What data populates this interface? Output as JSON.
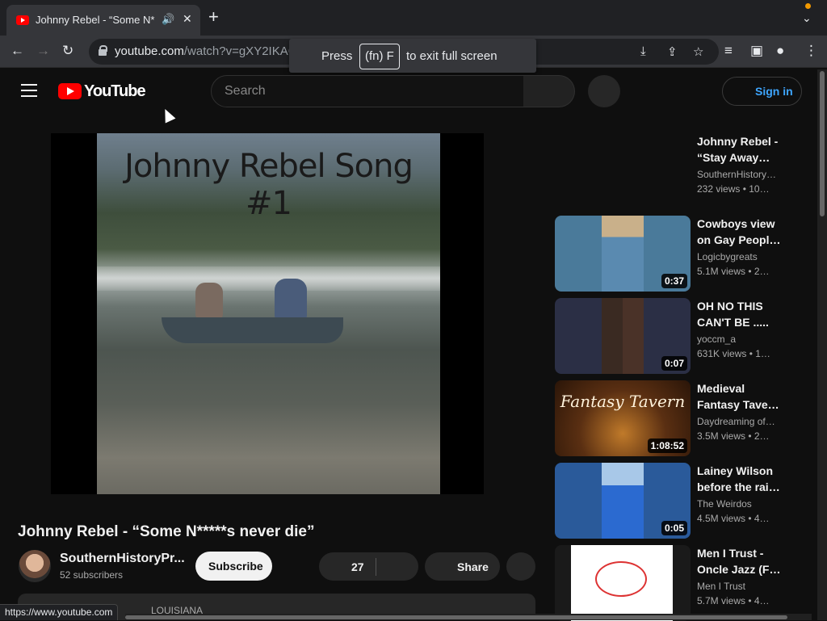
{
  "browser": {
    "tab_title": "Johnny Rebel - “Some N*",
    "url_domain": "youtube.com",
    "url_path": "/watch?v=gXY2IKAC",
    "url_hidden": "...",
    "fullscreen_toast": {
      "before": "Press",
      "key": "(fn) F",
      "after": "to exit full screen"
    },
    "status_url": "https://www.youtube.com"
  },
  "header": {
    "logo_text": "YouTube",
    "search_placeholder": "Search",
    "sign_in": "Sign in"
  },
  "player": {
    "overlay_title": "Johnny Rebel Song #1"
  },
  "video": {
    "title": "Johnny Rebel - “Some N*****s never die”",
    "channel": "SouthernHistoryPr...",
    "subscribers": "52 subscribers",
    "subscribe_label": "Subscribe",
    "likes": "27",
    "share_label": "Share",
    "description_peek": "LOUISIANA"
  },
  "recommendations": [
    {
      "title_line1": "Johnny Rebel -",
      "title_line2": "“Stay Away…",
      "channel": "SouthernHistory…",
      "meta": "232 views • 10…",
      "duration": ""
    },
    {
      "title_line1": "Cowboys view",
      "title_line2": "on Gay People…",
      "channel": "Logicbygreats",
      "meta": "5.1M views • 2…",
      "duration": "0:37"
    },
    {
      "title_line1": "OH NO THIS",
      "title_line2": "CAN'T BE .....",
      "channel": "yoccm_a",
      "meta": "631K views • 1…",
      "duration": "0:07"
    },
    {
      "title_line1": "Medieval",
      "title_line2": "Fantasy Taver…",
      "channel": "Daydreaming of …",
      "meta": "3.5M views • 2…",
      "duration": "1:08:52",
      "thumb_text": "Fantasy Tavern"
    },
    {
      "title_line1": "Lainey Wilson",
      "title_line2": "before the rai…",
      "channel": "The Weirdos",
      "meta": "4.5M views • 4…",
      "duration": "0:05"
    },
    {
      "title_line1": "Men I Trust -",
      "title_line2": "Oncle Jazz (F…",
      "channel": "Men I Trust",
      "meta": "5.7M views • 4…",
      "duration": ""
    }
  ],
  "colors": {
    "accent_red": "#ff0000",
    "link_blue": "#3ea6ff",
    "background": "#0f0f0f"
  },
  "icons": [
    "back-icon",
    "forward-icon",
    "reload-icon",
    "lock-icon",
    "install-icon",
    "share-icon",
    "star-icon",
    "media-icon",
    "sidepanel-icon",
    "profile-icon",
    "menu-dots-icon",
    "hamburger-icon",
    "search-icon",
    "mic-icon"
  ]
}
